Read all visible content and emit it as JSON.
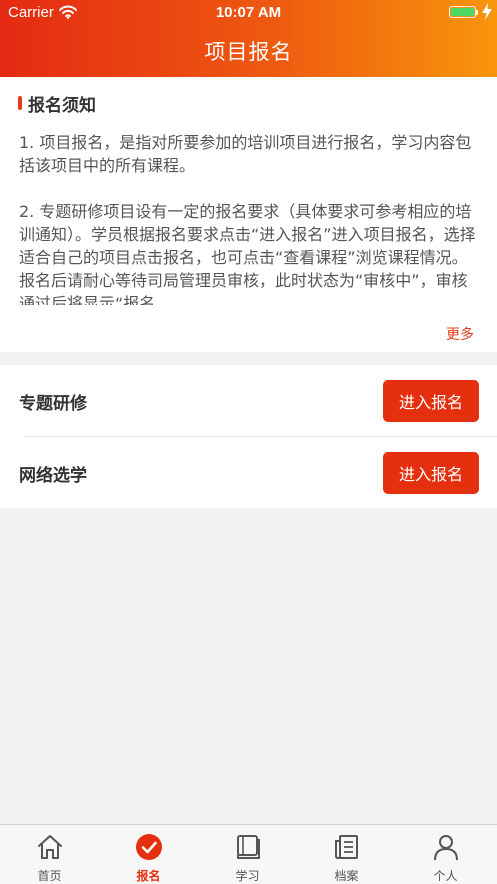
{
  "status_bar": {
    "carrier": "Carrier",
    "time": "10:07 AM"
  },
  "nav": {
    "title": "项目报名"
  },
  "notice": {
    "title": "报名须知",
    "paragraphs": [
      "1. 项目报名，是指对所要参加的培训项目进行报名，学习内容包括该项目中的所有课程。",
      "2. 专题研修项目设有一定的报名要求（具体要求可参考相应的培训通知）。学员根据报名要求点击“进入报名”进入项目报名，选择适合自己的项目点击报名，也可点击“查看课程”浏览课程情况。报名后请耐心等待司局管理员审核，此时状态为“审核中”，审核通过后将显示“报名"
    ],
    "more_label": "更多"
  },
  "projects": [
    {
      "name": "专题研修",
      "button_label": "进入报名"
    },
    {
      "name": "网络选学",
      "button_label": "进入报名"
    }
  ],
  "tabbar": {
    "tabs": [
      {
        "label": "首页",
        "icon": "home-icon"
      },
      {
        "label": "报名",
        "icon": "check-circle-icon"
      },
      {
        "label": "学习",
        "icon": "book-icon"
      },
      {
        "label": "档案",
        "icon": "document-icon"
      },
      {
        "label": "个人",
        "icon": "person-icon"
      }
    ],
    "active_index": 1
  },
  "colors": {
    "accent": "#e4300e",
    "header_gradient_start": "#e42a12",
    "header_gradient_end": "#f8960c",
    "battery": "#4cd964"
  },
  "battery_level": 1.0
}
